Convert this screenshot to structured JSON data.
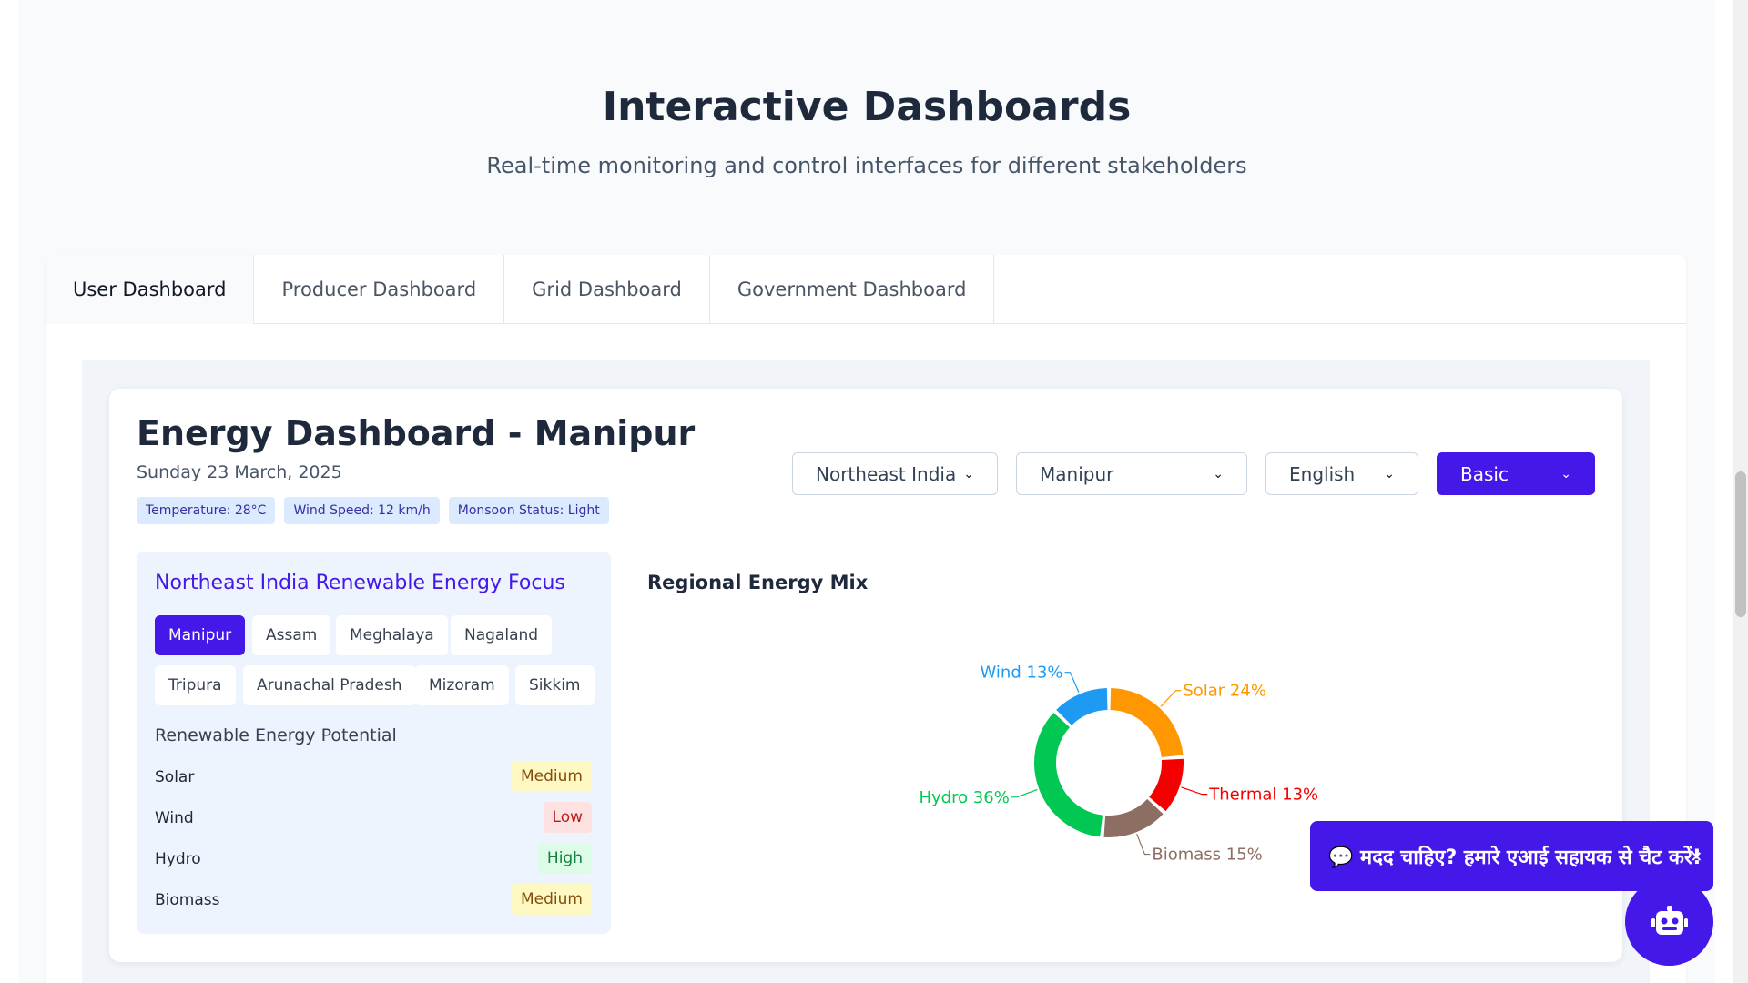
{
  "section": {
    "title": "Interactive Dashboards",
    "subtitle": "Real-time monitoring and control interfaces for different stakeholders"
  },
  "tabs": [
    {
      "label": "User Dashboard",
      "active": true
    },
    {
      "label": "Producer Dashboard",
      "active": false
    },
    {
      "label": "Grid Dashboard",
      "active": false
    },
    {
      "label": "Government Dashboard",
      "active": false
    }
  ],
  "dashboard": {
    "title": "Energy Dashboard - Manipur",
    "date": "Sunday 23 March, 2025",
    "badges": [
      "Temperature: 28°C",
      "Wind Speed: 12 km/h",
      "Monsoon Status: Light"
    ]
  },
  "selects": {
    "region": "Northeast India",
    "state": "Manipur",
    "language": "English",
    "mode": "Basic"
  },
  "focus": {
    "title": "Northeast India Renewable Energy Focus",
    "states": [
      "Manipur",
      "Assam",
      "Meghalaya",
      "Nagaland",
      "Tripura",
      "Arunachal Pradesh",
      "Mizoram",
      "Sikkim"
    ],
    "active_state": "Manipur",
    "potential_title": "Renewable Energy Potential",
    "potential": [
      {
        "label": "Solar",
        "level": "Medium"
      },
      {
        "label": "Wind",
        "level": "Low"
      },
      {
        "label": "Hydro",
        "level": "High"
      },
      {
        "label": "Biomass",
        "level": "Medium"
      }
    ]
  },
  "level_colors": {
    "Medium": {
      "bg": "#fef9c3",
      "fg": "#854d0e"
    },
    "Low": {
      "bg": "#fee2e2",
      "fg": "#b91c1c"
    },
    "High": {
      "bg": "#dcfce7",
      "fg": "#15803d"
    }
  },
  "chart_data": {
    "type": "pie",
    "title": "Regional Energy Mix",
    "series": [
      {
        "name": "Solar",
        "value": 24,
        "color": "#ff9800"
      },
      {
        "name": "Thermal",
        "value": 13,
        "color": "#f40000"
      },
      {
        "name": "Biomass",
        "value": 15,
        "color": "#8d6e63"
      },
      {
        "name": "Hydro",
        "value": 36,
        "color": "#00c853"
      },
      {
        "name": "Wind",
        "value": 13,
        "color": "#1e9af3"
      }
    ]
  },
  "chat": {
    "banner": "💬 मदद चाहिए? हमारे एआई सहायक से चैट करें!",
    "close": "×"
  },
  "colors": {
    "accent": "#4318e8"
  }
}
